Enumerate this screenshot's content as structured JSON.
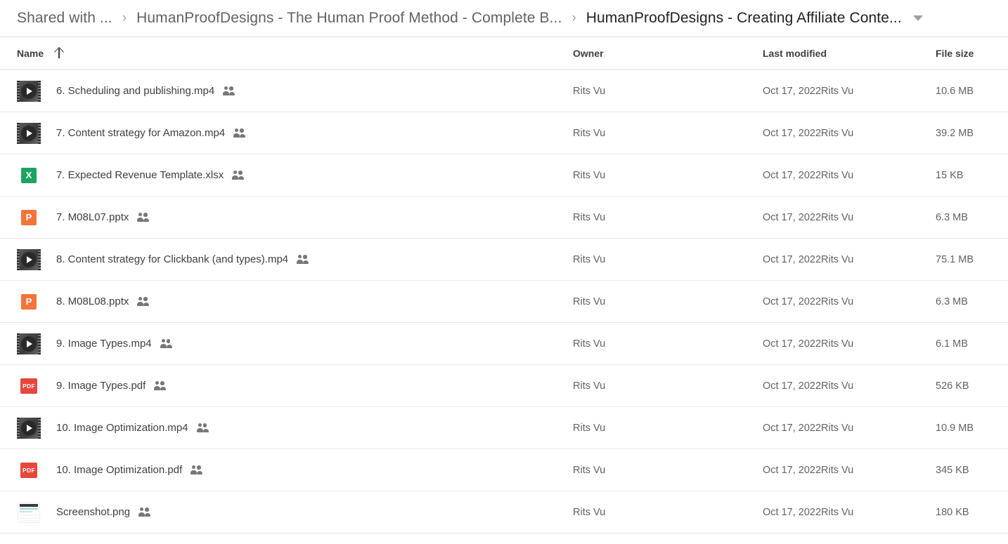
{
  "breadcrumb": {
    "items": [
      {
        "label": "Shared with ...",
        "active": false
      },
      {
        "label": "HumanProofDesigns - The Human Proof Method - Complete B...",
        "active": false
      },
      {
        "label": "HumanProofDesigns - Creating Affiliate Conte...",
        "active": true
      }
    ],
    "separator": "›",
    "caret_icon": "chevron-down-icon"
  },
  "columns": {
    "name": "Name",
    "owner": "Owner",
    "modified": "Last modified",
    "size": "File size",
    "sort_icon": "arrow-up-icon",
    "sorted_by": "Name",
    "sort_direction": "ascending"
  },
  "colors": {
    "excel_green": "#1ea362",
    "powerpoint_orange": "#f4743b",
    "pdf_red": "#e8453c",
    "text_primary": "#3c4043",
    "text_secondary": "#5f6368",
    "divider": "#e8eaed"
  },
  "files": [
    {
      "name": "6. Scheduling and publishing.mp4",
      "icon": "video-thumbnail-icon",
      "shared": true,
      "shared_icon": "people-shared-icon",
      "owner": "Rits Vu",
      "modified_date": "Oct 17, 2022",
      "modified_by": "Rits Vu",
      "size": "10.6 MB"
    },
    {
      "name": "7. Content strategy for Amazon.mp4",
      "icon": "video-thumbnail-icon",
      "shared": true,
      "shared_icon": "people-shared-icon",
      "owner": "Rits Vu",
      "modified_date": "Oct 17, 2022",
      "modified_by": "Rits Vu",
      "size": "39.2 MB"
    },
    {
      "name": "7. Expected Revenue Template.xlsx",
      "icon": "excel-icon",
      "shared": true,
      "shared_icon": "people-shared-icon",
      "owner": "Rits Vu",
      "modified_date": "Oct 17, 2022",
      "modified_by": "Rits Vu",
      "size": "15 KB"
    },
    {
      "name": "7. M08L07.pptx",
      "icon": "powerpoint-icon",
      "shared": true,
      "shared_icon": "people-shared-icon",
      "owner": "Rits Vu",
      "modified_date": "Oct 17, 2022",
      "modified_by": "Rits Vu",
      "size": "6.3 MB"
    },
    {
      "name": "8. Content strategy for Clickbank (and types).mp4",
      "icon": "video-thumbnail-icon",
      "shared": true,
      "shared_icon": "people-shared-icon",
      "owner": "Rits Vu",
      "modified_date": "Oct 17, 2022",
      "modified_by": "Rits Vu",
      "size": "75.1 MB"
    },
    {
      "name": "8. M08L08.pptx",
      "icon": "powerpoint-icon",
      "shared": true,
      "shared_icon": "people-shared-icon",
      "owner": "Rits Vu",
      "modified_date": "Oct 17, 2022",
      "modified_by": "Rits Vu",
      "size": "6.3 MB"
    },
    {
      "name": "9. Image Types.mp4",
      "icon": "video-thumbnail-icon",
      "shared": true,
      "shared_icon": "people-shared-icon",
      "owner": "Rits Vu",
      "modified_date": "Oct 17, 2022",
      "modified_by": "Rits Vu",
      "size": "6.1 MB"
    },
    {
      "name": "9. Image Types.pdf",
      "icon": "pdf-icon",
      "shared": true,
      "shared_icon": "people-shared-icon",
      "owner": "Rits Vu",
      "modified_date": "Oct 17, 2022",
      "modified_by": "Rits Vu",
      "size": "526 KB"
    },
    {
      "name": "10. Image Optimization.mp4",
      "icon": "video-thumbnail-icon",
      "shared": true,
      "shared_icon": "people-shared-icon",
      "owner": "Rits Vu",
      "modified_date": "Oct 17, 2022",
      "modified_by": "Rits Vu",
      "size": "10.9 MB"
    },
    {
      "name": "10. Image Optimization.pdf",
      "icon": "pdf-icon",
      "shared": true,
      "shared_icon": "people-shared-icon",
      "owner": "Rits Vu",
      "modified_date": "Oct 17, 2022",
      "modified_by": "Rits Vu",
      "size": "345 KB"
    },
    {
      "name": "Screenshot.png",
      "icon": "image-thumbnail-icon",
      "shared": true,
      "shared_icon": "people-shared-icon",
      "owner": "Rits Vu",
      "modified_date": "Oct 17, 2022",
      "modified_by": "Rits Vu",
      "size": "180 KB"
    }
  ],
  "icon_labels": {
    "excel": "X",
    "powerpoint": "P",
    "pdf": "PDF"
  }
}
